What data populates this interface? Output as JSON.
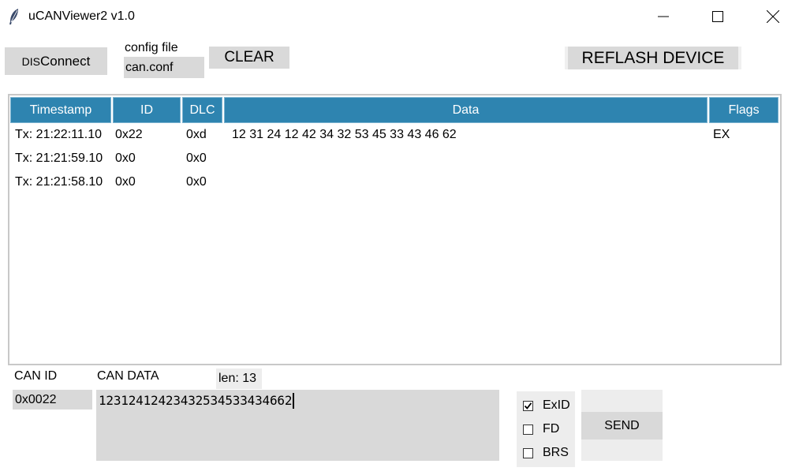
{
  "window": {
    "title": "uCANViewer2 v1.0",
    "icon": "feather-icon"
  },
  "toolbar": {
    "disconnect_prefix": "DIS",
    "disconnect_label": "Connect",
    "config_label": "config file",
    "config_value": "can.conf",
    "clear_label": "CLEAR",
    "reflash_label": "REFLASH DEVICE"
  },
  "table": {
    "headers": {
      "timestamp": "Timestamp",
      "id": "ID",
      "dlc": "DLC",
      "data": "Data",
      "flags": "Flags"
    },
    "rows": [
      {
        "timestamp": "Tx: 21:22:11.10",
        "id": "0x22",
        "dlc": "0xd",
        "data": "12 31 24 12 42 34 32 53 45 33 43 46 62",
        "flags": "EX"
      },
      {
        "timestamp": "Tx: 21:21:59.10",
        "id": "0x0",
        "dlc": "0x0",
        "data": "",
        "flags": ""
      },
      {
        "timestamp": "Tx: 21:21:58.10",
        "id": "0x0",
        "dlc": "0x0",
        "data": "",
        "flags": ""
      }
    ]
  },
  "compose": {
    "can_id_label": "CAN ID",
    "can_data_label": "CAN DATA",
    "len_label": "len: 13",
    "can_id_value": "0x0022",
    "can_data_value": "12312412423432534533434662",
    "exid_label": "ExID",
    "exid_checked": true,
    "fd_label": "FD",
    "fd_checked": false,
    "brs_label": "BRS",
    "brs_checked": false,
    "send_label": "SEND"
  },
  "colors": {
    "header_bg": "#2e84b0",
    "button_bg": "#d9d9d9"
  }
}
